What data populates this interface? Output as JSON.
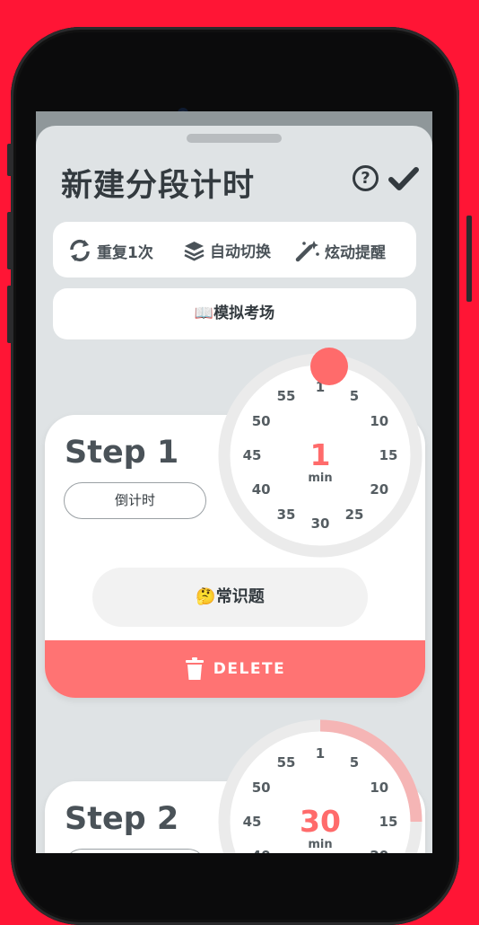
{
  "header": {
    "title": "新建分段计时",
    "help_icon": "?"
  },
  "options": [
    {
      "icon": "repeat-icon",
      "label": "重复1次"
    },
    {
      "icon": "layers-icon",
      "label": "自动切换"
    },
    {
      "icon": "magic-wand-icon",
      "label": "炫动提醒"
    }
  ],
  "exam_button": {
    "label": "📖模拟考场"
  },
  "dial_labels": [
    "1",
    "5",
    "10",
    "15",
    "20",
    "25",
    "30",
    "35",
    "40",
    "45",
    "50",
    "55"
  ],
  "steps": [
    {
      "title": "Step 1",
      "mode": "倒计时",
      "label": "🤔常识题",
      "minutes": "1",
      "unit": "min",
      "delete": "DELETE"
    },
    {
      "title": "Step 2",
      "minutes": "30",
      "unit": "min"
    }
  ],
  "colors": {
    "accent": "#ff6b6b",
    "background": "#ff1535",
    "text": "#333a3f"
  }
}
